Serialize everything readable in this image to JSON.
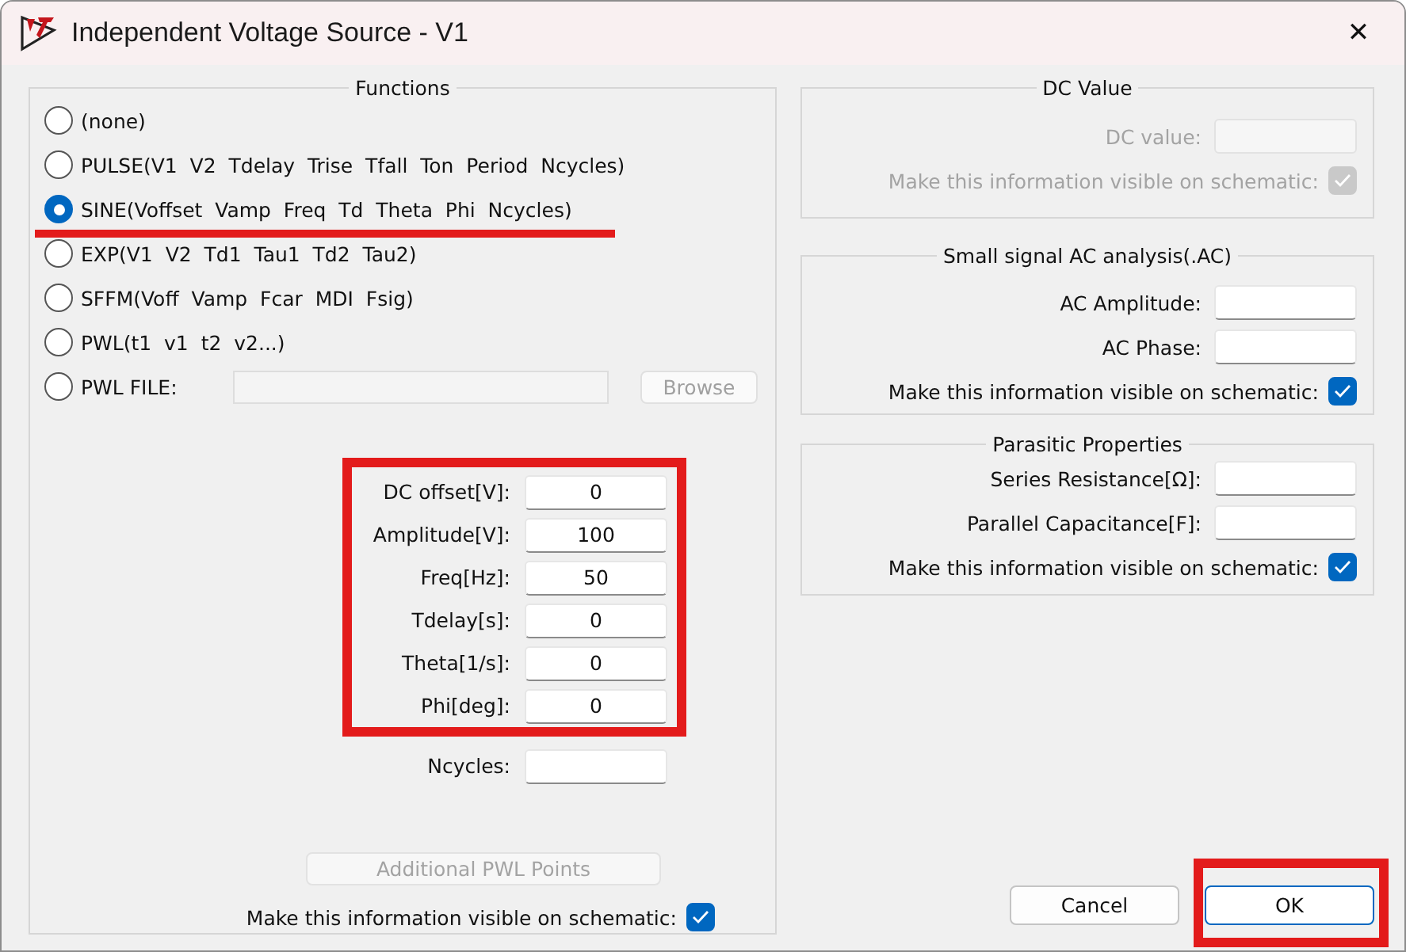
{
  "window": {
    "title": "Independent Voltage Source - V1",
    "close": "✕"
  },
  "functions": {
    "title": "Functions",
    "options": [
      {
        "kind": "radio",
        "label": "(none)",
        "selected": false,
        "highlighted": false
      },
      {
        "kind": "radio",
        "label": "PULSE(V1  V2  Tdelay  Trise  Tfall  Ton  Period  Ncycles)",
        "selected": false,
        "highlighted": false
      },
      {
        "kind": "radio",
        "label": "SINE(Voffset  Vamp  Freq  Td  Theta  Phi  Ncycles)",
        "selected": true,
        "highlighted": true
      },
      {
        "kind": "radio",
        "label": "EXP(V1  V2  Td1  Tau1  Td2  Tau2)",
        "selected": false,
        "highlighted": false
      },
      {
        "kind": "radio",
        "label": "SFFM(Voff  Vamp  Fcar  MDI  Fsig)",
        "selected": false,
        "highlighted": false
      },
      {
        "kind": "radio",
        "label": "PWL(t1  v1  t2  v2...)",
        "selected": false,
        "highlighted": false
      },
      {
        "kind": "file",
        "label": "PWL FILE:",
        "selected": false,
        "highlighted": false,
        "disabled": true,
        "browse_button": "Browse"
      }
    ]
  },
  "params": [
    {
      "label": "DC offset[V]:",
      "value": "0",
      "highlighted": true
    },
    {
      "label": "Amplitude[V]:",
      "value": "100",
      "highlighted": true
    },
    {
      "label": "Freq[Hz]:",
      "value": "50",
      "highlighted": true
    },
    {
      "label": "Tdelay[s]:",
      "value": "0",
      "highlighted": true
    },
    {
      "label": "Theta[1/s]:",
      "value": "0",
      "highlighted": true
    },
    {
      "label": "Phi[deg]:",
      "value": "0",
      "highlighted": true
    },
    {
      "label": "Ncycles:",
      "highlighted": false
    }
  ],
  "additional_pwl_button": {
    "label": "Additional PWL Points",
    "disabled": true
  },
  "visible_checkbox": {
    "label": "Make this information visible on schematic:",
    "checked": true
  },
  "dc_value": {
    "title": "DC Value",
    "disabled": true,
    "fields": [
      {
        "label": "DC value:"
      }
    ],
    "visible_checkbox": {
      "label": "Make this information visible on schematic:",
      "checked": true
    }
  },
  "ac": {
    "title": "Small signal AC analysis(.AC)",
    "disabled": false,
    "fields": [
      {
        "label": "AC Amplitude:"
      },
      {
        "label": "AC Phase:"
      }
    ],
    "visible_checkbox": {
      "label": "Make this information visible on schematic:",
      "checked": true
    }
  },
  "parasitic": {
    "title": "Parasitic Properties",
    "disabled": false,
    "fields": [
      {
        "label": "Series Resistance[Ω]:"
      },
      {
        "label": "Parallel Capacitance[F]:"
      }
    ],
    "visible_checkbox": {
      "label": "Make this information visible on schematic:",
      "checked": true
    }
  },
  "buttons": [
    {
      "label": "Cancel",
      "highlighted": false
    },
    {
      "label": "OK",
      "highlighted": true
    }
  ]
}
